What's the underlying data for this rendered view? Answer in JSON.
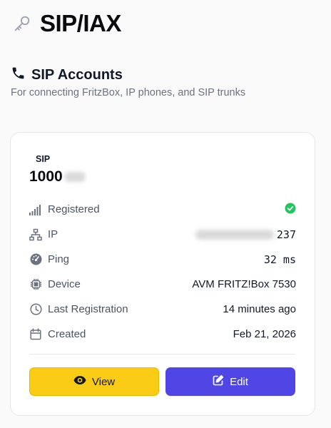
{
  "page": {
    "title": "SIP/IAX"
  },
  "section": {
    "title": "SIP Accounts",
    "subtitle": "For connecting FritzBox, IP phones, and SIP trunks"
  },
  "account": {
    "type": "SIP",
    "id": "1000",
    "rows": [
      {
        "icon": "signal-icon",
        "label": "Registered",
        "value": ""
      },
      {
        "icon": "network-icon",
        "label": "IP",
        "value": "237"
      },
      {
        "icon": "gauge-icon",
        "label": "Ping",
        "value": "32 ms"
      },
      {
        "icon": "cpu-icon",
        "label": "Device",
        "value": "AVM FRITZ!Box 7530"
      },
      {
        "icon": "clock-icon",
        "label": "Last Registration",
        "value": "14 minutes ago"
      },
      {
        "icon": "calendar-icon",
        "label": "Created",
        "value": "Feb 21, 2026"
      }
    ],
    "status_color": "#22c55e"
  },
  "actions": {
    "view_label": "View",
    "edit_label": "Edit",
    "view_color": "#facc15",
    "edit_color": "#4f46e5"
  }
}
